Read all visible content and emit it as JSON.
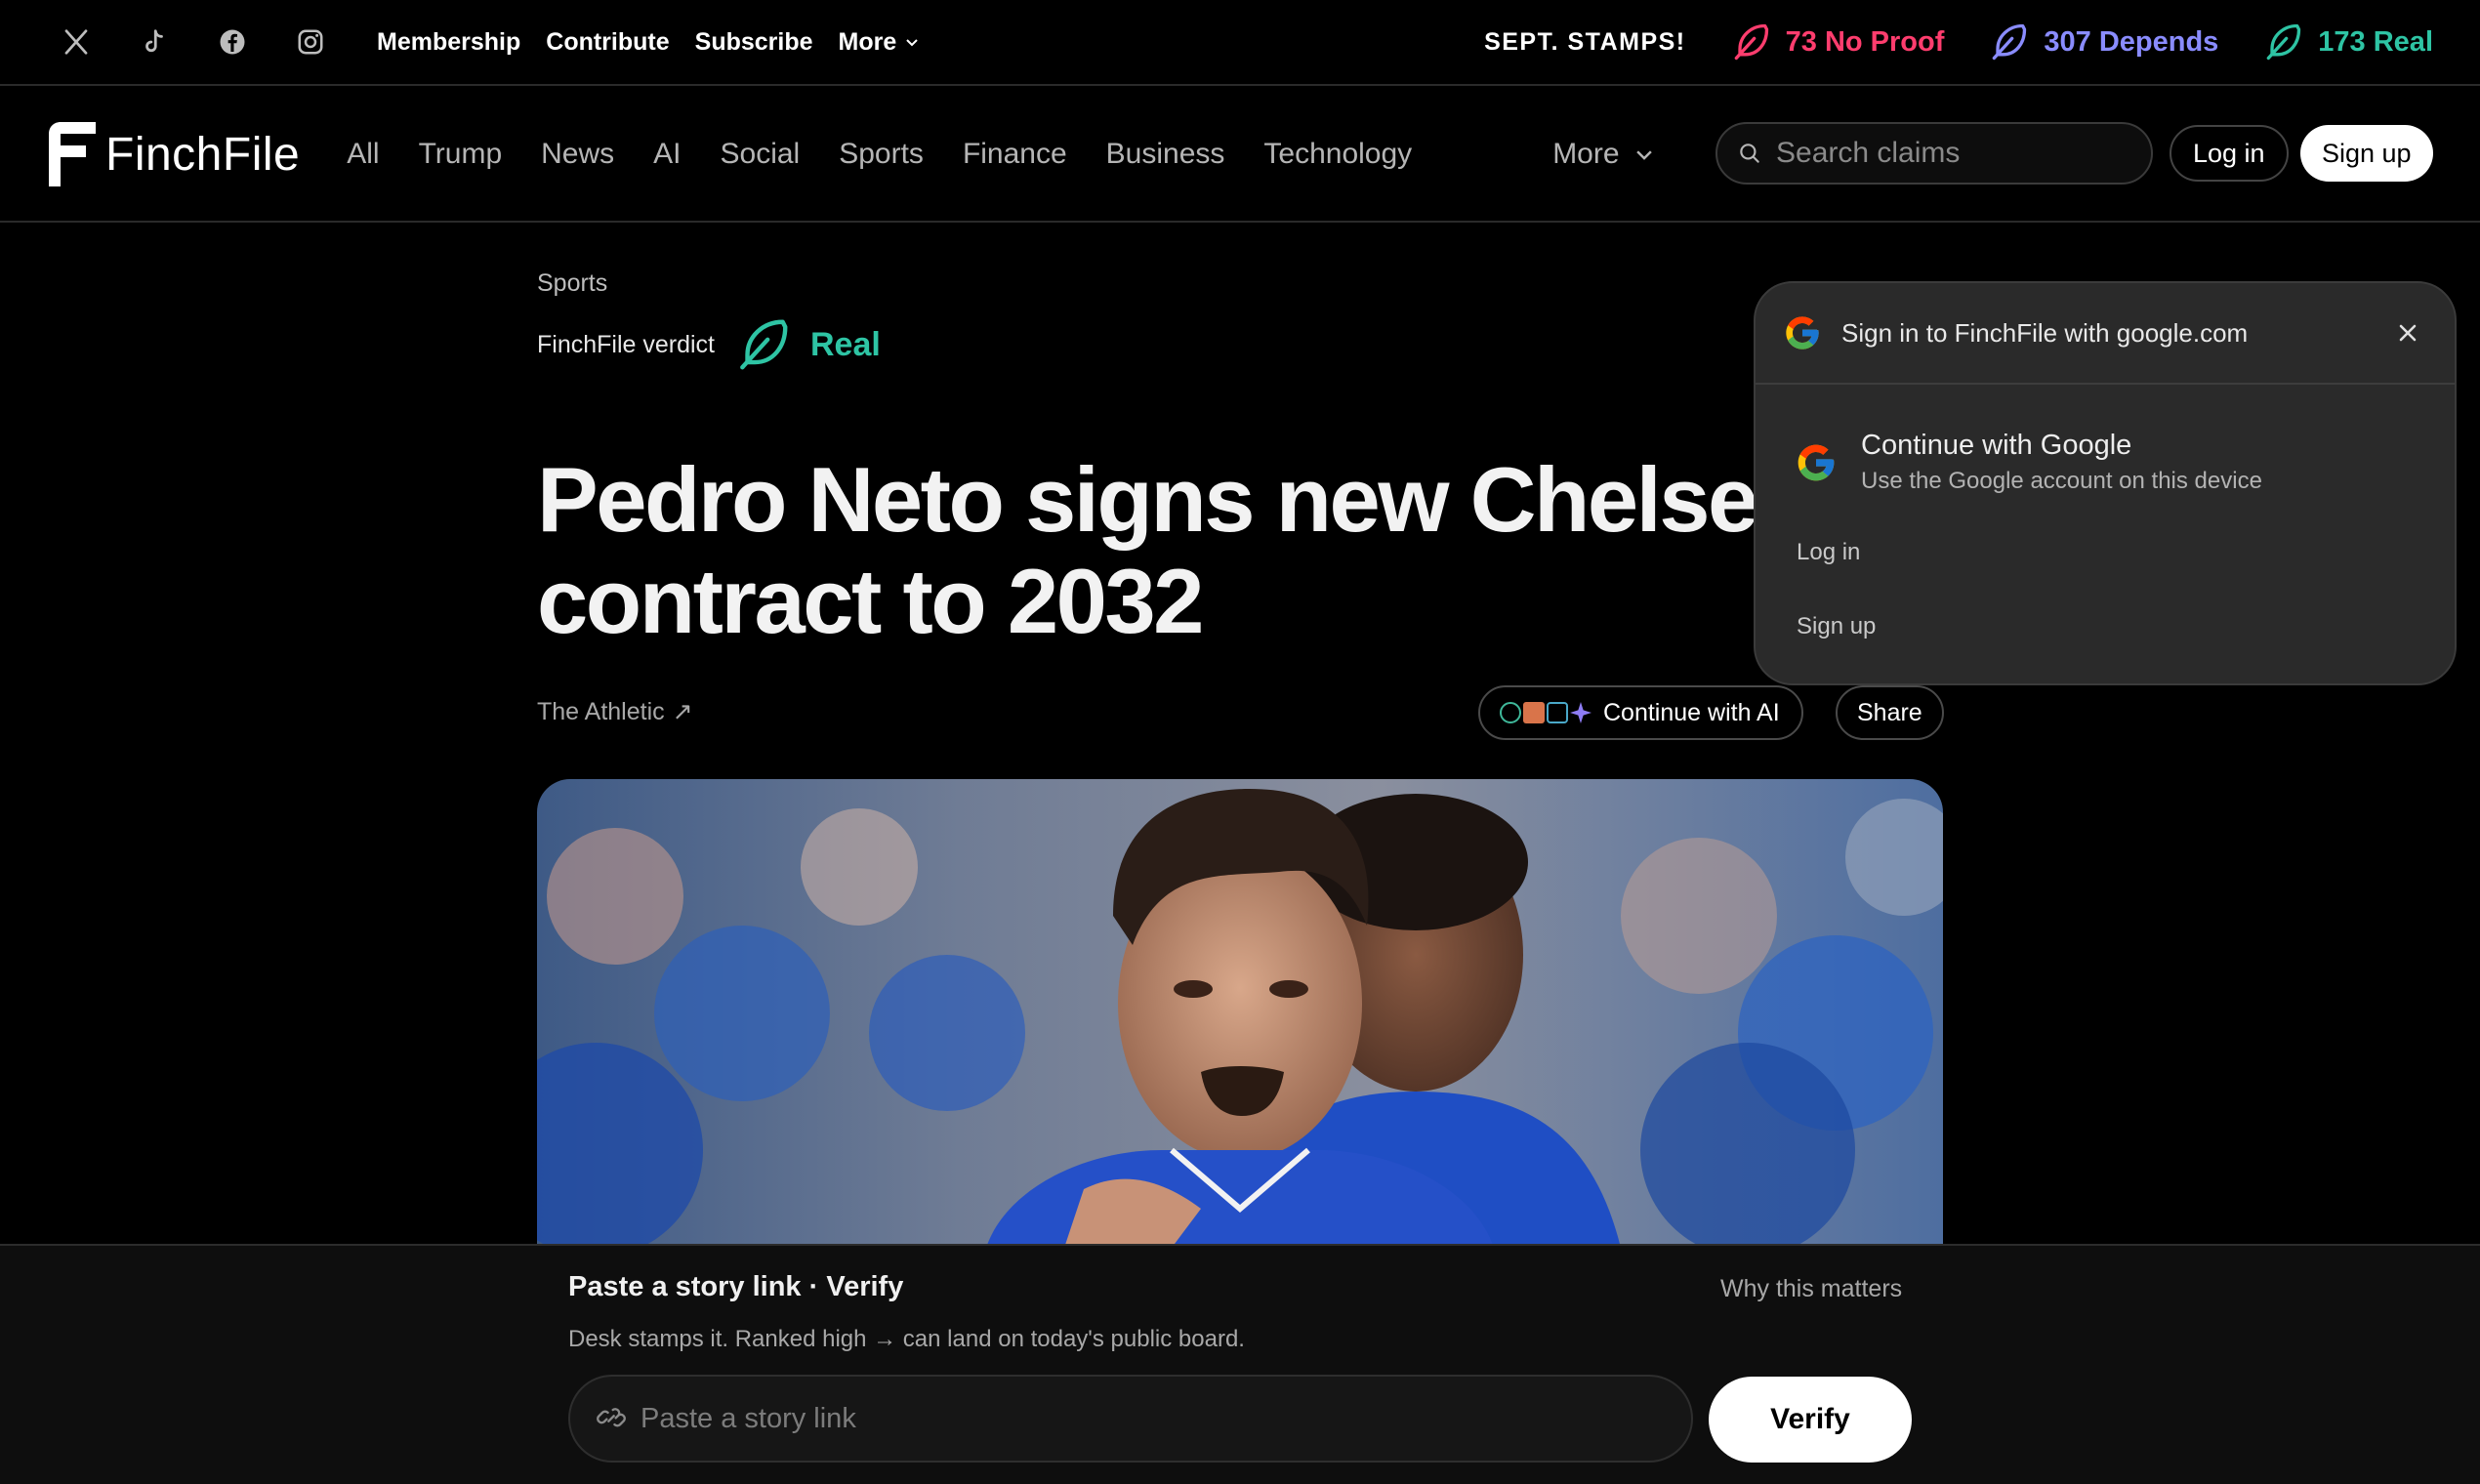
{
  "topbar": {
    "social_icons": [
      "x-icon",
      "tiktok-icon",
      "facebook-icon",
      "instagram-icon"
    ],
    "links": [
      "Membership",
      "Contribute",
      "Subscribe"
    ],
    "more_label": "More",
    "stamps_label": "SEPT. STAMPS!",
    "stats": [
      {
        "label": "73 No Proof",
        "color": "#ff3d6e"
      },
      {
        "label": "307 Depends",
        "color": "#8a8cff"
      },
      {
        "label": "173 Real",
        "color": "#2ec4a4"
      }
    ]
  },
  "nav": {
    "logo_text": "FinchFile",
    "categories": [
      "All",
      "Trump",
      "News",
      "AI",
      "Social",
      "Sports",
      "Finance",
      "Business",
      "Technology"
    ],
    "more_label": "More",
    "search_placeholder": "Search claims",
    "login_label": "Log in",
    "signup_label": "Sign up"
  },
  "article": {
    "kicker": "Sports",
    "verdict_label": "FinchFile verdict",
    "verdict_value": "Real",
    "verdict_color": "#2ec4a4",
    "headline_line1": "Pedro Neto signs new Chelsea",
    "headline_line2": "contract to 2032",
    "source": "The Athletic",
    "source_arrow": "↗",
    "ai_button": "Continue with AI",
    "share_button": "Share"
  },
  "google_popup": {
    "title": "Sign in to FinchFile with google.com",
    "continue_title": "Continue with Google",
    "continue_sub": "Use the Google account on this device",
    "login": "Log in",
    "signup": "Sign up"
  },
  "verify_bar": {
    "title": "Paste a story link · Verify",
    "why": "Why this matters",
    "subtitle": "Desk stamps it. Ranked high → can land on today's public board.",
    "input_placeholder": "Paste a story link",
    "button": "Verify"
  }
}
